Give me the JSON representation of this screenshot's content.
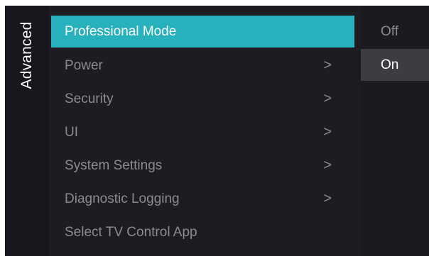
{
  "sidebar": {
    "label": "Advanced"
  },
  "menu": {
    "items": [
      {
        "label": "Professional Mode",
        "selected": true,
        "has_submenu": false
      },
      {
        "label": "Power",
        "selected": false,
        "has_submenu": true
      },
      {
        "label": "Security",
        "selected": false,
        "has_submenu": true
      },
      {
        "label": "UI",
        "selected": false,
        "has_submenu": true
      },
      {
        "label": "System Settings",
        "selected": false,
        "has_submenu": true
      },
      {
        "label": "Diagnostic Logging",
        "selected": false,
        "has_submenu": true
      },
      {
        "label": "Select TV Control App",
        "selected": false,
        "has_submenu": false
      }
    ],
    "chevron_glyph": ">"
  },
  "options": {
    "items": [
      {
        "label": "Off",
        "current": false
      },
      {
        "label": "On",
        "current": true
      }
    ]
  },
  "colors": {
    "highlight": "#27b1bd",
    "background": "#15151b",
    "dim_text": "#8a8a90",
    "current_option": "#3c3c42"
  }
}
